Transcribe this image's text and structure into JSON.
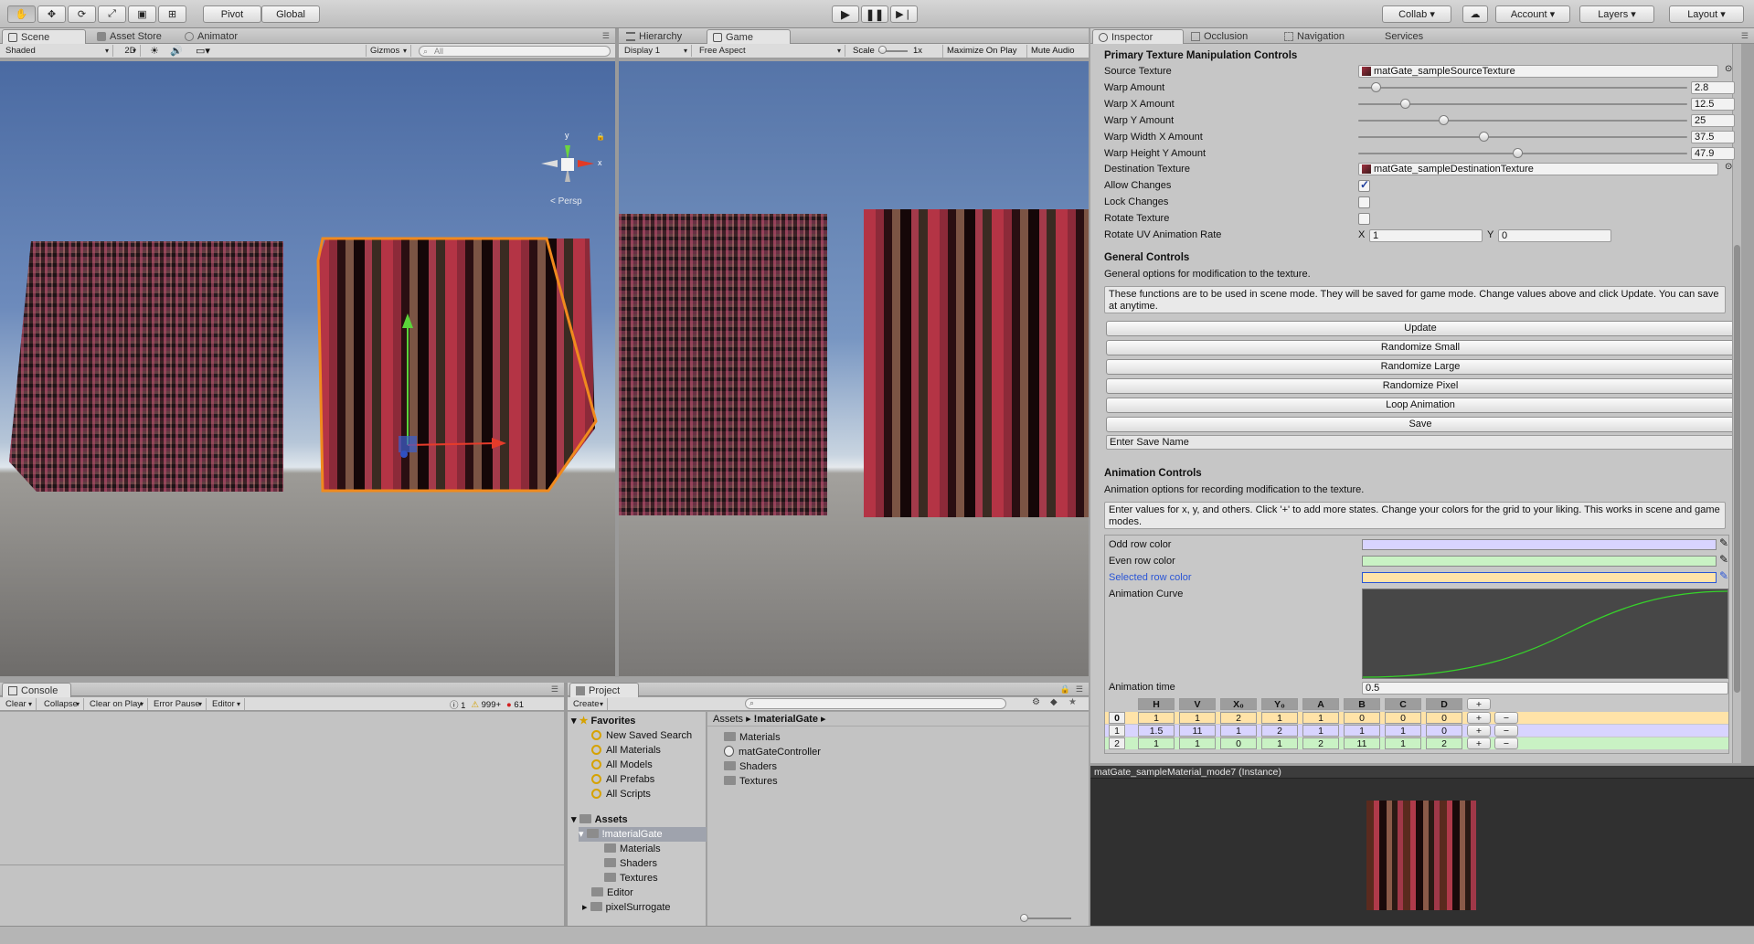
{
  "toolbar": {
    "tools": [
      "hand-tool",
      "move-tool",
      "rotate-tool",
      "scale-tool",
      "rect-tool",
      "transform-tool"
    ],
    "pivot_label": "Pivot",
    "global_label": "Global",
    "collab_label": "Collab",
    "account_label": "Account",
    "layers_label": "Layers",
    "layout_label": "Layout"
  },
  "scene_panel": {
    "tabs": [
      "Scene",
      "Asset Store",
      "Animator"
    ],
    "shading": "Shaded",
    "mode_2d": "2D",
    "gizmos": "Gizmos",
    "search_placeholder": "All",
    "persp_label": "Persp",
    "gizmo_y": "y",
    "gizmo_x": "x"
  },
  "game_panel": {
    "tabs": [
      "Hierarchy",
      "Game"
    ],
    "display": "Display 1",
    "aspect": "Free Aspect",
    "scale_label": "Scale",
    "scale_value": "1x",
    "maximize": "Maximize On Play",
    "mute": "Mute Audio"
  },
  "inspector": {
    "tabs": [
      "Inspector",
      "Occlusion",
      "Navigation",
      "Services"
    ],
    "primary_header": "Primary Texture Manipulation Controls",
    "source_texture_label": "Source Texture",
    "source_texture_value": "matGate_sampleSourceTexture",
    "sliders": [
      {
        "label": "Warp Amount",
        "value": "2.8",
        "fraction": 0.04
      },
      {
        "label": "Warp X Amount",
        "value": "12.5",
        "fraction": 0.13
      },
      {
        "label": "Warp Y Amount",
        "value": "25",
        "fraction": 0.25
      },
      {
        "label": "Warp Width X Amount",
        "value": "37.5",
        "fraction": 0.375
      },
      {
        "label": "Warp Height Y Amount",
        "value": "47.9",
        "fraction": 0.48
      }
    ],
    "dest_texture_label": "Destination Texture",
    "dest_texture_value": "matGate_sampleDestinationTexture",
    "allow_changes_label": "Allow Changes",
    "allow_changes_checked": true,
    "lock_changes_label": "Lock Changes",
    "lock_changes_checked": false,
    "rotate_texture_label": "Rotate Texture",
    "rotate_texture_checked": false,
    "rotate_uv_label": "Rotate UV Animation Rate",
    "rotate_uv_x_label": "X",
    "rotate_uv_x": "1",
    "rotate_uv_y_label": "Y",
    "rotate_uv_y": "0",
    "general_header": "General Controls",
    "general_desc": "General options for modification to the texture.",
    "general_help": "These functions are to be used in scene mode. They will be saved for game mode. Change values above and click Update. You can save at anytime.",
    "buttons": [
      "Update",
      "Randomize Small",
      "Randomize Large",
      "Randomize Pixel",
      "Loop Animation",
      "Save"
    ],
    "save_name_placeholder": "Enter Save Name",
    "anim_header": "Animation Controls",
    "anim_desc": "Animation options for recording modification to the texture.",
    "anim_help": "Enter values for x, y, and others. Click '+' to add more states. Change your colors for the grid to your liking. This works in scene and game modes.",
    "odd_row_label": "Odd row color",
    "odd_row_color": "#d8d4ff",
    "even_row_label": "Even row color",
    "even_row_color": "#c9f2c4",
    "selected_row_label": "Selected row color",
    "selected_row_color": "#ffe3a8",
    "anim_curve_label": "Animation Curve",
    "anim_time_label": "Animation time",
    "anim_time_value": "0.5",
    "grid_headers": [
      "H",
      "V",
      "X₀",
      "Y₀",
      "A",
      "B",
      "C",
      "D"
    ],
    "grid_rows": [
      {
        "index": "0",
        "values": [
          "1",
          "1",
          "2",
          "1",
          "1",
          "0",
          "0",
          "0"
        ]
      },
      {
        "index": "1",
        "values": [
          "1.5",
          "11",
          "1",
          "2",
          "1",
          "1",
          "1",
          "0"
        ]
      },
      {
        "index": "2",
        "values": [
          "1",
          "1",
          "0",
          "1",
          "2",
          "11",
          "1",
          "2"
        ]
      }
    ],
    "plus": "+",
    "minus": "−"
  },
  "preview": {
    "title": "matGate_sampleMaterial_mode7 (Instance)"
  },
  "console": {
    "tab": "Console",
    "buttons": [
      "Clear",
      "Collapse",
      "Clear on Play",
      "Error Pause"
    ],
    "editor_dropdown": "Editor",
    "log_count": "1",
    "warn_count": "999+",
    "error_count": "61"
  },
  "project": {
    "tab": "Project",
    "create_label": "Create",
    "favorites_label": "Favorites",
    "favorites": [
      "New Saved Search",
      "All Materials",
      "All Models",
      "All Prefabs",
      "All Scripts"
    ],
    "assets_label": "Assets",
    "tree": [
      "!materialGate",
      "Materials",
      "Shaders",
      "Textures",
      "Editor",
      "pixelSurrogate"
    ],
    "breadcrumb_root": "Assets",
    "breadcrumb_current": "!materialGate",
    "contents": [
      "Materials",
      "matGateController",
      "Shaders",
      "Textures"
    ]
  }
}
